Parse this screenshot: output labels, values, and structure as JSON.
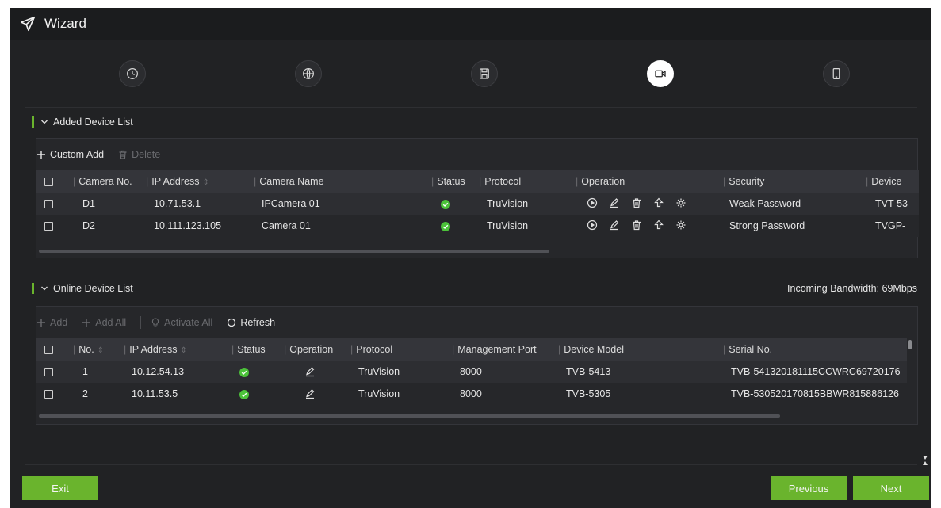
{
  "window": {
    "title": "Wizard"
  },
  "steps": [
    {
      "icon": "clock-icon"
    },
    {
      "icon": "globe-icon"
    },
    {
      "icon": "save-disk-icon"
    },
    {
      "icon": "camera-icon",
      "active": true
    },
    {
      "icon": "mobile-phone-icon"
    }
  ],
  "added": {
    "title": "Added Device List",
    "toolbar": {
      "custom_add": "Custom Add",
      "delete": "Delete"
    },
    "columns": [
      "Camera No.",
      "IP Address",
      "Camera Name",
      "Status",
      "Protocol",
      "Operation",
      "Security",
      "Device"
    ],
    "rows": [
      {
        "no": "D1",
        "ip": "10.71.53.1",
        "name": "IPCamera 01",
        "protocol": "TruVision",
        "security": "Weak Password",
        "device": "TVT-53"
      },
      {
        "no": "D2",
        "ip": "10.111.123.105",
        "name": "Camera 01",
        "protocol": "TruVision",
        "security": "Strong Password",
        "device": "TVGP-"
      }
    ]
  },
  "online": {
    "title": "Online Device List",
    "bandwidth": "Incoming Bandwidth: 69Mbps",
    "toolbar": {
      "add": "Add",
      "add_all": "Add All",
      "activate_all": "Activate All",
      "refresh": "Refresh"
    },
    "columns": [
      "No.",
      "IP Address",
      "Status",
      "Operation",
      "Protocol",
      "Management Port",
      "Device Model",
      "Serial No."
    ],
    "rows": [
      {
        "no": "1",
        "ip": "10.12.54.13",
        "protocol": "TruVision",
        "port": "8000",
        "model": "TVB-5413",
        "serial": "TVB-541320181115CCWRC69720176"
      },
      {
        "no": "2",
        "ip": "10.11.53.5",
        "protocol": "TruVision",
        "port": "8000",
        "model": "TVB-5305",
        "serial": "TVB-530520170815BBWR815886126"
      }
    ]
  },
  "footer": {
    "exit": "Exit",
    "previous": "Previous",
    "next": "Next"
  },
  "colors": {
    "accent": "#6ab42d",
    "background": "#212224",
    "panel": "#26272a",
    "status_ok": "#4cc23a"
  }
}
